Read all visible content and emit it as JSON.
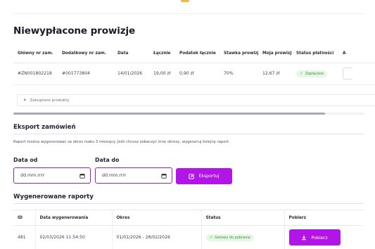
{
  "page_title": "Niewypłacone prowizje",
  "commissions": {
    "headers": [
      "Główny nr zam.",
      "Dodatkowy nr zam.",
      "Data",
      "Łącznie",
      "Podatek łącznie",
      "Stawka prowizji",
      "Moja prowizja",
      "Status płatności",
      "A"
    ],
    "row": {
      "main_order": "#ZN001802218",
      "extra_order": "#001773804",
      "date": "14/01/2026",
      "total": "19,00 zł",
      "tax": "0,90 zł",
      "rate": "70%",
      "commission": "12,67 zł",
      "status": "Zapłacone"
    },
    "products_label": "Zakupione produkty",
    "scroll_position": 0.89
  },
  "export": {
    "title": "Eksport zamówień",
    "description": "Raport można wygenerować za okres maks 3 miesięcy. Jeśli chcesz zobaczyć inne okresy, wygeneruj kolejny raport.",
    "date_from_label": "Data od",
    "date_to_label": "Data do",
    "date_from_value": "dd.mm.rrrr",
    "date_to_value": "dd.mm.rrrr",
    "export_button": "Eksportuj"
  },
  "reports": {
    "title": "Wygenerowane raporty",
    "headers": [
      "ID",
      "Data wygenerowania",
      "Okres",
      "Status",
      "Pobierz"
    ],
    "rows": [
      {
        "id": "481",
        "generated": "02/03/2026 11:54:50",
        "period": "01/01/2026 - 28/02/2026",
        "status": "Gotowy do pobrania",
        "download": "Pobierz"
      }
    ]
  },
  "colors": {
    "accent": "#b116e6",
    "success_bg": "#e7f7e6",
    "success_text": "#3f8f3a"
  }
}
